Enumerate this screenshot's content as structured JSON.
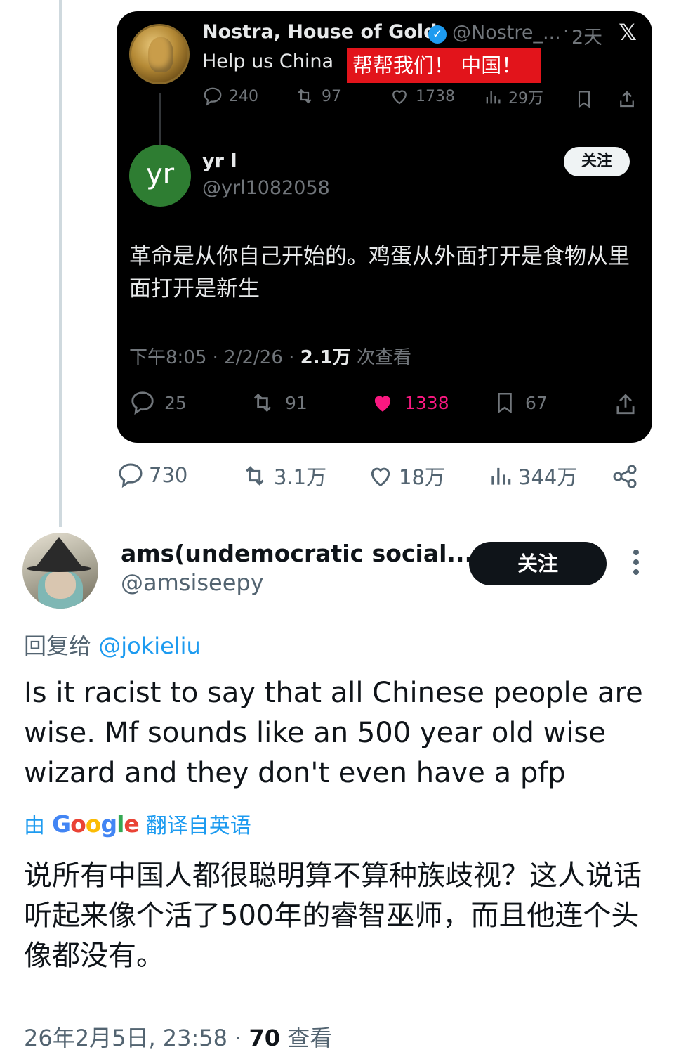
{
  "quoted_card": {
    "parent": {
      "name": "Nostra, House of Gold",
      "handle": "@Nostre_...",
      "dot": "·",
      "age": "2天",
      "text": "Help us China",
      "overlay_tag": "帮帮我们！ 中国！",
      "stats": {
        "replies": "240",
        "reposts": "97",
        "likes": "1738",
        "views": "29万"
      }
    },
    "reply": {
      "avatar_text": "yr",
      "name": "yr l",
      "handle": "@yrl1082058",
      "follow_label": "关注",
      "text": "革命是从你自己开始的。鸡蛋从外面打开是食物从里面打开是新生",
      "meta_prefix": "下午8:05 · 2/2/26 · ",
      "meta_views": "2.1万",
      "meta_suffix": " 次查看",
      "stats": {
        "replies": "25",
        "reposts": "91",
        "likes": "1338",
        "bookmarks": "67"
      }
    }
  },
  "outer_actions": {
    "replies": "730",
    "reposts": "3.1万",
    "likes": "18万",
    "views": "344万"
  },
  "reply_tweet": {
    "name": "ams(undemocratic social...",
    "handle": "@amsiseepy",
    "follow_label": "关注",
    "reply_to_prefix": "回复给 ",
    "reply_to_mention": "@jokieliu",
    "text": "Is it racist to say that all Chinese people are wise. Mf sounds like an 500 year old wise wizard and they don't even have a pfp",
    "translate_prefix": "由",
    "translate_suffix": "翻译自英语",
    "translated_text": "说所有中国人都很聪明算不算种族歧视？这人说话听起来像个活了500年的睿智巫师，而且他连个头像都没有。",
    "meta_prefix": "26年2月5日, 23:58 · ",
    "meta_views": "70",
    "meta_suffix": " 查看"
  },
  "colors": {
    "accent": "#1d9bf0",
    "like": "#f91880",
    "overlay_red": "#e2141b",
    "card_bg": "#000000"
  },
  "icons": [
    "verified-badge-icon",
    "x-logo-icon",
    "reply-icon",
    "repost-icon",
    "like-icon",
    "views-icon",
    "bookmark-icon",
    "share-icon",
    "more-icon"
  ]
}
